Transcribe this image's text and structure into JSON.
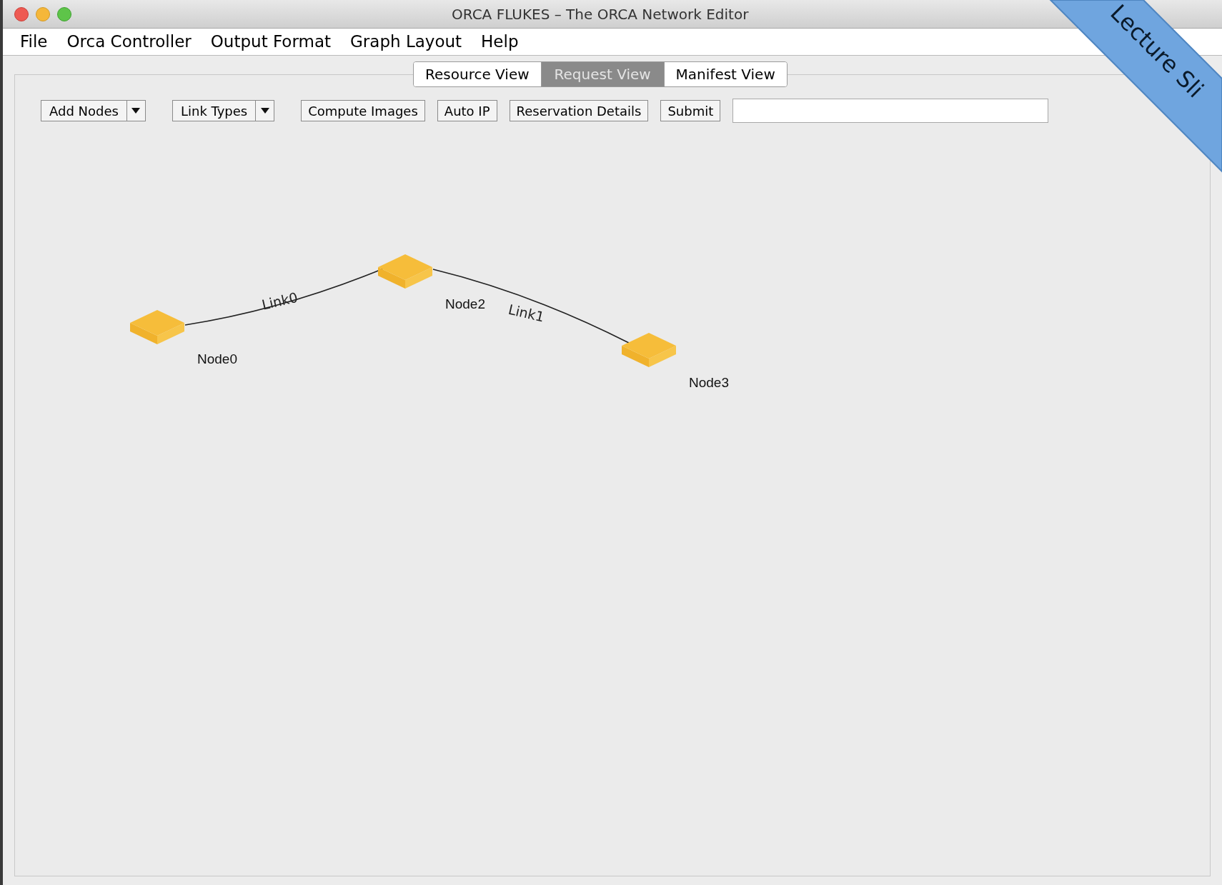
{
  "window": {
    "title": "ORCA FLUKES – The ORCA Network Editor"
  },
  "menu": [
    "File",
    "Orca Controller",
    "Output Format",
    "Graph Layout",
    "Help"
  ],
  "tabs": [
    {
      "label": "Resource View",
      "selected": false
    },
    {
      "label": "Request View",
      "selected": true
    },
    {
      "label": "Manifest View",
      "selected": false
    }
  ],
  "toolbar": [
    {
      "kind": "dropdown",
      "label": "Add Nodes"
    },
    {
      "kind": "dropdown",
      "label": "Link Types"
    },
    {
      "kind": "button",
      "label": "Compute Images"
    },
    {
      "kind": "button",
      "label": "Auto IP"
    },
    {
      "kind": "button",
      "label": "Reservation Details"
    },
    {
      "kind": "button",
      "label": "Submit"
    },
    {
      "kind": "field"
    }
  ],
  "graph": {
    "nodes": [
      {
        "label": "Node0"
      },
      {
        "label": "Node2"
      },
      {
        "label": "Node3"
      }
    ],
    "links": [
      {
        "label": "Link0"
      },
      {
        "label": "Link1"
      }
    ]
  },
  "corner_banner": {
    "text": "Lecture Sli"
  }
}
